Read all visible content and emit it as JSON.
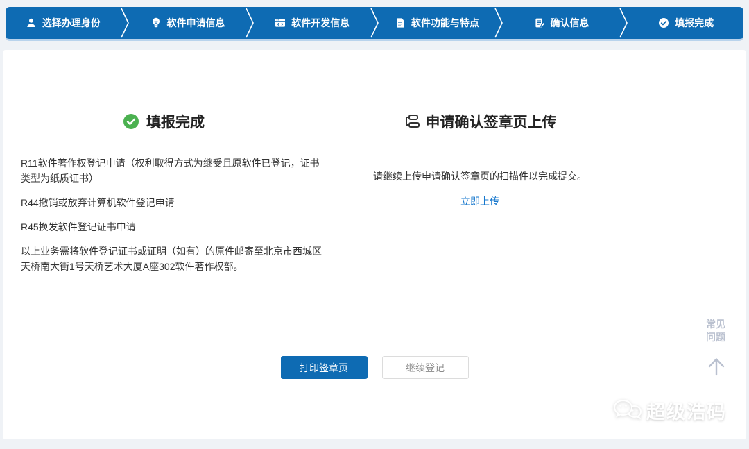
{
  "colors": {
    "primary_blue": "#0e6bb3",
    "link_blue": "#1677cd",
    "success_green": "#4bb150",
    "page_background": "#eff2f6",
    "muted_gray": "#b9c0cf"
  },
  "stepper": {
    "steps": [
      {
        "label": "选择办理身份",
        "icon": "user-icon"
      },
      {
        "label": "软件申请信息",
        "icon": "bulb-icon"
      },
      {
        "label": "软件开发信息",
        "icon": "code-window-icon"
      },
      {
        "label": "软件功能与特点",
        "icon": "document-icon"
      },
      {
        "label": "确认信息",
        "icon": "clipboard-edit-icon"
      },
      {
        "label": "填报完成",
        "icon": "check-circle-icon"
      }
    ]
  },
  "left_panel": {
    "title": "填报完成",
    "paragraphs": [
      "R11软件著作权登记申请（权利取得方式为继受且原软件已登记，证书类型为纸质证书）",
      "R44撤销或放弃计算机软件登记申请",
      "R45换发软件登记证书申请",
      "以上业务需将软件登记证书或证明（如有）的原件邮寄至北京市西城区天桥南大街1号天桥艺术大厦A座302软件著作权部。"
    ]
  },
  "right_panel": {
    "title": "申请确认签章页上传",
    "description": "请继续上传申请确认签章页的扫描件以完成提交。",
    "upload_link": "立即上传"
  },
  "actions": {
    "print_label": "打印签章页",
    "continue_label": "继续登记"
  },
  "floating": {
    "faq_line1": "常见",
    "faq_line2": "问题"
  },
  "watermark": {
    "text": "超级浩码"
  }
}
